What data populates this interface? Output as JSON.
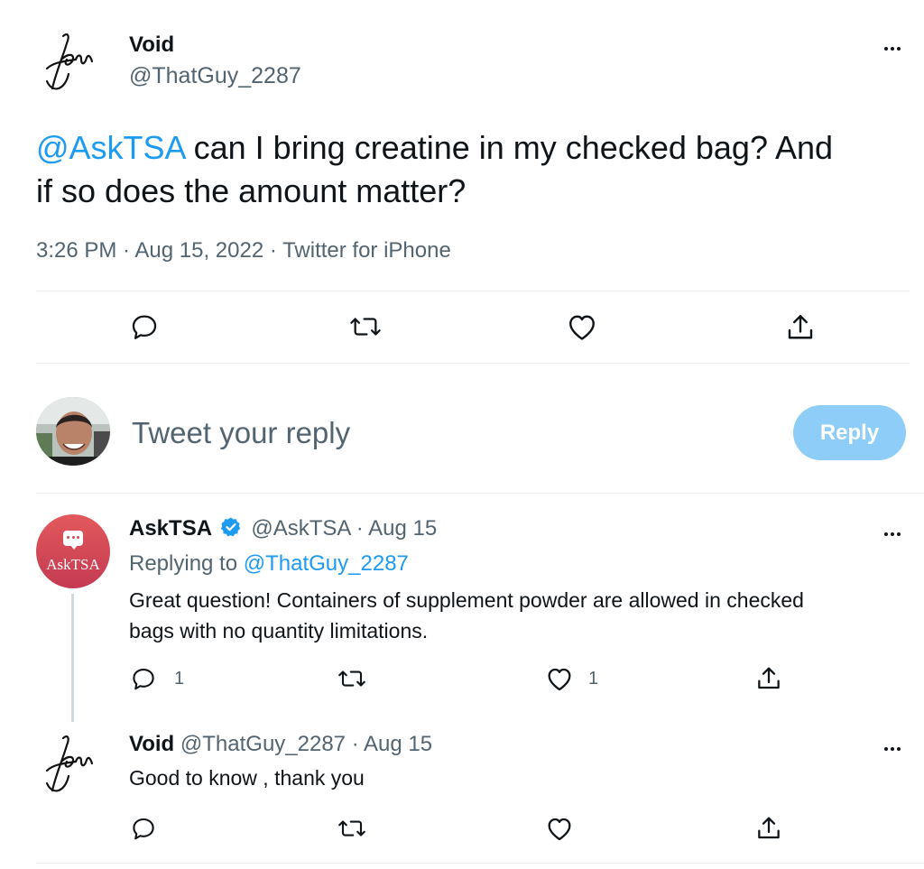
{
  "main_tweet": {
    "name": "Void",
    "handle": "@ThatGuy_2287",
    "mention": "@AskTSA",
    "text_line1": " can I bring creatine in my checked bag? And",
    "text_line2": "if so does the amount matter?",
    "meta": "3:26 PM · Aug 15, 2022 · Twitter for iPhone"
  },
  "reply_box": {
    "placeholder": "Tweet your reply",
    "button_label": "Reply"
  },
  "reply_1": {
    "name": "AskTSA",
    "handle": "@AskTSA",
    "date": "· Aug 15",
    "avatar_text": "AskTSA",
    "replying_prefix": "Replying to ",
    "replying_to": "@ThatGuy_2287",
    "text_line1": "Great question! Containers of supplement powder are allowed in checked",
    "text_line2": "bags with no quantity limitations.",
    "reply_count": "1",
    "like_count": "1"
  },
  "reply_2": {
    "name": "Void",
    "handle": "@ThatGuy_2287",
    "date": "· Aug 15",
    "text": "Good to know , thank you"
  },
  "colors": {
    "accent": "#1d9bf0",
    "reply_button": "#8ecdf8",
    "verified": "#1d9bf0",
    "asktsa_avatar_top": "#e0575a",
    "asktsa_avatar_bottom": "#c93b54"
  },
  "icons": [
    "signature-avatar",
    "more-icon",
    "reply-icon",
    "retweet-icon",
    "like-icon",
    "share-icon",
    "verified-badge-icon",
    "chat-bubble-icon"
  ]
}
